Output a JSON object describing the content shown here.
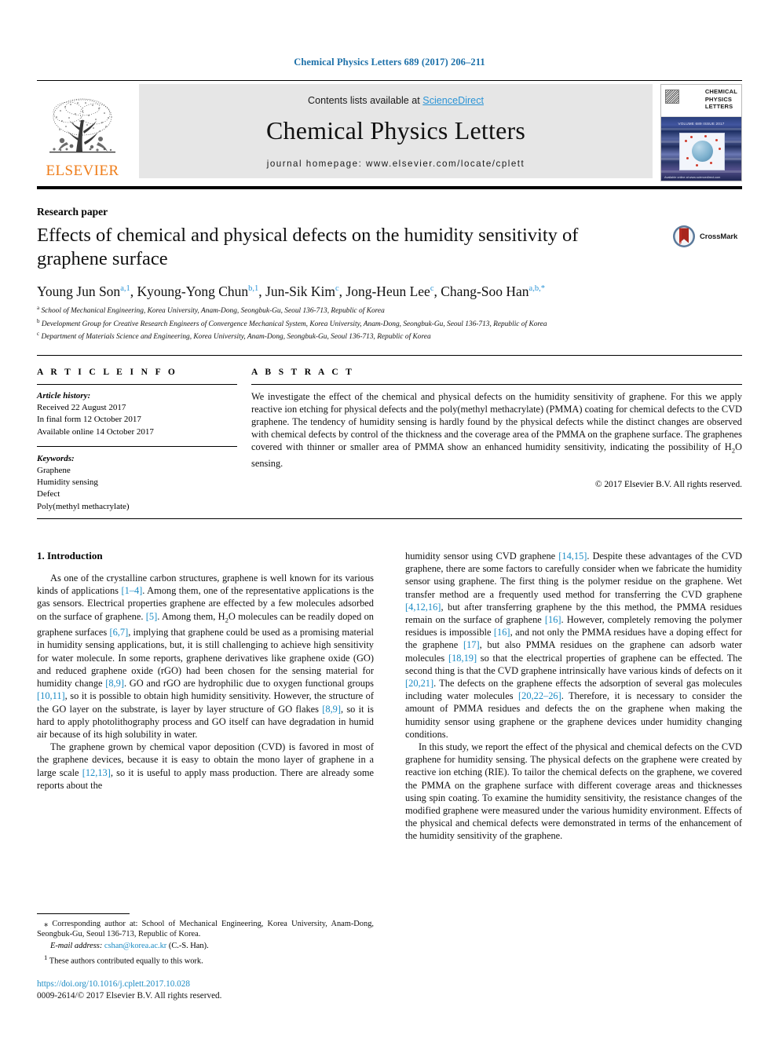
{
  "running_head": "Chemical Physics Letters 689 (2017) 206–211",
  "masthead": {
    "contents_prefix": "Contents lists available at ",
    "sciencedirect": "ScienceDirect",
    "journal_title": "Chemical Physics Letters",
    "homepage": "journal homepage: www.elsevier.com/locate/cplett",
    "publisher_logo_text": "ELSEVIER",
    "cover": {
      "title_line1": "CHEMICAL",
      "title_line2": "PHYSICS",
      "title_line3": "LETTERS",
      "issue_line": "VOLUME 689  ISSUE  2017",
      "footer_line": "Available online at www.sciencedirect.com"
    }
  },
  "article": {
    "type": "Research paper",
    "title": "Effects of chemical and physical defects on the humidity sensitivity of graphene surface",
    "crossmark_label": "CrossMark",
    "authors": [
      {
        "name": "Young Jun Son",
        "sup": "a,1",
        "sep": ", "
      },
      {
        "name": "Kyoung-Yong Chun",
        "sup": "b,1",
        "sep": ", "
      },
      {
        "name": "Jun-Sik Kim",
        "sup": "c",
        "sep": ", "
      },
      {
        "name": "Jong-Heun Lee",
        "sup": "c",
        "sep": ", "
      },
      {
        "name": "Chang-Soo Han",
        "sup": "a,b,*",
        "sep": ""
      }
    ],
    "affiliations": [
      {
        "marker": "a",
        "text": "School of Mechanical Engineering, Korea University, Anam-Dong, Seongbuk-Gu, Seoul 136-713, Republic of Korea"
      },
      {
        "marker": "b",
        "text": "Development Group for Creative Research Engineers of Convergence Mechanical System, Korea University, Anam-Dong, Seongbuk-Gu, Seoul 136-713, Republic of Korea"
      },
      {
        "marker": "c",
        "text": "Department of Materials Science and Engineering, Korea University, Anam-Dong, Seongbuk-Gu, Seoul 136-713, Republic of Korea"
      }
    ]
  },
  "article_info": {
    "heading": "A R T I C L E   I N F O",
    "history_title": "Article history:",
    "history": [
      "Received 22 August 2017",
      "In final form 12 October 2017",
      "Available online 14 October 2017"
    ],
    "keywords_title": "Keywords:",
    "keywords": [
      "Graphene",
      "Humidity sensing",
      "Defect",
      "Poly(methyl methacrylate)"
    ]
  },
  "abstract": {
    "heading": "A B S T R A C T",
    "text": "We investigate the effect of the chemical and physical defects on the humidity sensitivity of graphene. For this we apply reactive ion etching for physical defects and the poly(methyl methacrylate) (PMMA) coating for chemical defects to the CVD graphene. The tendency of humidity sensing is hardly found by the physical defects while the distinct changes are observed with chemical defects by control of the thickness and the coverage area of the PMMA on the graphene surface. The graphenes covered with thinner or smaller area of PMMA show an enhanced humidity sensitivity, indicating the possibility of H2O sensing.",
    "copyright": "© 2017 Elsevier B.V. All rights reserved."
  },
  "body": {
    "section_title": "1. Introduction",
    "left_paragraphs": [
      "As one of the crystalline carbon structures, graphene is well known for its various kinds of applications [1–4]. Among them, one of the representative applications is the gas sensors. Electrical properties graphene are effected by a few molecules adsorbed on the surface of graphene. [5]. Among them, H2O molecules can be readily doped on graphene surfaces [6,7], implying that graphene could be used as a promising material in humidity sensing applications, but, it is still challenging to achieve high sensitivity for water molecule. In some reports, graphene derivatives like graphene oxide (GO) and reduced graphene oxide (rGO) had been chosen for the sensing material for humidity change [8,9]. GO and rGO are hydrophilic due to oxygen functional groups [10,11], so it is possible to obtain high humidity sensitivity. However, the structure of the GO layer on the substrate, is layer by layer structure of GO flakes [8,9], so it is hard to apply photolithography process and GO itself can have degradation in humid air because of its high solubility in water.",
      "The graphene grown by chemical vapor deposition (CVD) is favored in most of the graphene devices, because it is easy to obtain the mono layer of graphene in a large scale [12,13], so it is useful to apply mass production. There are already some reports about the"
    ],
    "right_paragraphs": [
      "humidity sensor using CVD graphene [14,15]. Despite these advantages of the CVD graphene, there are some factors to carefully consider when we fabricate the humidity sensor using graphene. The first thing is the polymer residue on the graphene. Wet transfer method are a frequently used method for transferring the CVD graphene [4,12,16], but after transferring graphene by the this method, the PMMA residues remain on the surface of graphene [16]. However, completely removing the polymer residues is impossible [16], and not only the PMMA residues have a doping effect for the graphene [17], but also PMMA residues on the graphene can adsorb water molecules [18,19] so that the electrical properties of graphene can be effected. The second thing is that the CVD graphene intrinsically have various kinds of defects on it [20,21]. The defects on the graphene effects the adsorption of several gas molecules including water molecules [20,22–26]. Therefore, it is necessary to consider the amount of PMMA residues and defects the on the graphene when making the humidity sensor using graphene or the graphene devices under humidity changing conditions.",
      "In this study, we report the effect of the physical and chemical defects on the CVD graphene for humidity sensing. The physical defects on the graphene were created by reactive ion etching (RIE). To tailor the chemical defects on the graphene, we covered the PMMA on the graphene surface with different coverage areas and thicknesses using spin coating. To examine the humidity sensitivity, the resistance changes of the modified graphene were measured under the various humidity environment. Effects of the physical and chemical defects were demonstrated in terms of the enhancement of the humidity sensitivity of the graphene."
    ]
  },
  "footnotes": {
    "corresponding": "Corresponding author at: School of Mechanical Engineering, Korea University, Anam-Dong, Seongbuk-Gu, Seoul 136-713, Republic of Korea.",
    "email_label": "E-mail address:",
    "email": "cshan@korea.ac.kr",
    "email_suffix": " (C.-S. Han).",
    "equal_contrib": "These authors contributed equally to this work."
  },
  "footer": {
    "doi": "https://doi.org/10.1016/j.cplett.2017.10.028",
    "issn": "0009-2614/© 2017 Elsevier B.V. All rights reserved."
  },
  "colors": {
    "link": "#1b8bc4",
    "header_blue": "#1b6fa8",
    "elsevier_orange": "#ef7d1a",
    "banner_bg": "#e6e6e6"
  }
}
